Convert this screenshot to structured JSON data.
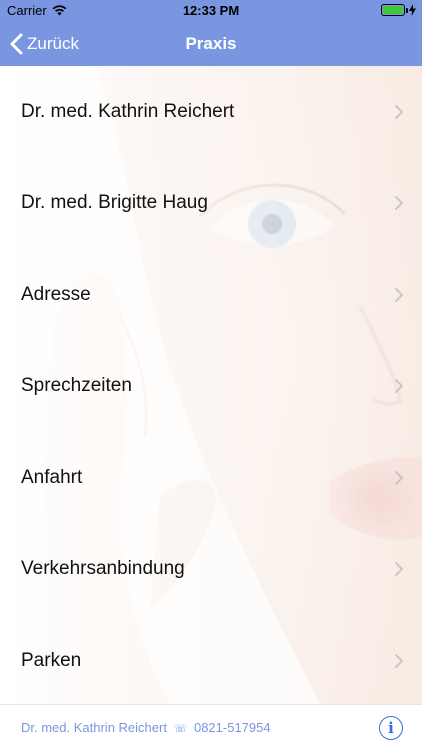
{
  "status_bar": {
    "carrier": "Carrier",
    "time": "12:33 PM",
    "battery_level": 1.0,
    "icons": [
      "wifi-icon",
      "battery-icon",
      "charging-bolt-icon"
    ]
  },
  "nav": {
    "back_label": "Zurück",
    "title": "Praxis",
    "color": "#7b96e0"
  },
  "menu": {
    "items": [
      {
        "label": "Dr. med. Kathrin Reichert"
      },
      {
        "label": "Dr. med. Brigitte Haug"
      },
      {
        "label": "Adresse"
      },
      {
        "label": "Sprechzeiten"
      },
      {
        "label": "Anfahrt"
      },
      {
        "label": "Verkehrsanbindung"
      },
      {
        "label": "Parken"
      }
    ]
  },
  "footer": {
    "name": "Dr. med. Kathrin Reichert",
    "phone_icon": "☏",
    "phone": "0821-517954",
    "info_icon": "i",
    "accent": "#7b96e0"
  }
}
